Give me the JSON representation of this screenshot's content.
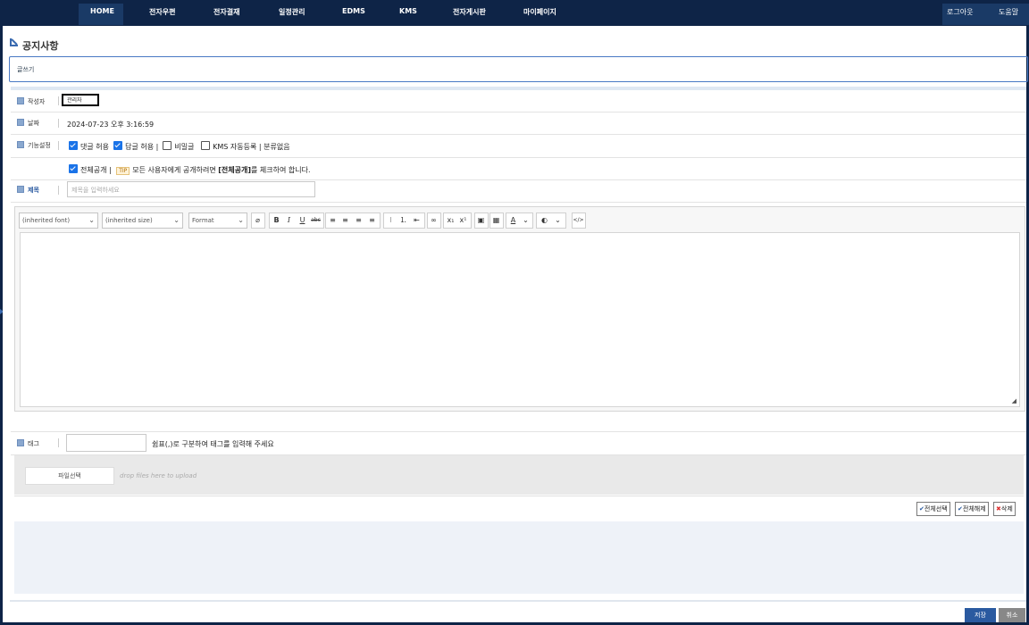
{
  "nav": {
    "items": [
      "HOME",
      "전자우편",
      "전자결재",
      "일정관리",
      "EDMS",
      "KMS",
      "전자게시판",
      "마이페이지"
    ],
    "logout": "로그아웃",
    "help": "도움말"
  },
  "page": {
    "title": "공지사항",
    "write_tab": "글쓰기"
  },
  "form": {
    "author_label": "작성자",
    "author_value": "관리자",
    "date_label": "날짜",
    "date_value": "2024-07-23 오후 3:16:59",
    "settings_label": "기능설정",
    "opt_comment": "댓글 허용",
    "opt_reply": "답글 허용",
    "opt_secret": "비밀글",
    "opt_kms": "KMS 자동등록",
    "opt_kms_suffix": "분류없음",
    "opt_public": "전체공개",
    "tip_badge": "TIP",
    "tip_text_pre": "모든 사용자에게 공개하려면",
    "tip_text_bold": "[전체공개]",
    "tip_text_post": "를 체크하여 합니다.",
    "subject_label": "제목",
    "subject_placeholder": "제목을 입력하세요",
    "tag_label": "태그",
    "tag_hint": "쉼표(,)로 구분하여 태그를 입력해 주세요"
  },
  "editor": {
    "font": "(inherited font)",
    "size": "(inherited size)",
    "format": "Format"
  },
  "upload": {
    "file_button": "파일선택",
    "drop_hint": "drop files here to upload",
    "select_all": "전체선택",
    "deselect_all": "전체해제",
    "delete": "삭제"
  },
  "actions": {
    "save": "저장",
    "cancel": "취소"
  }
}
